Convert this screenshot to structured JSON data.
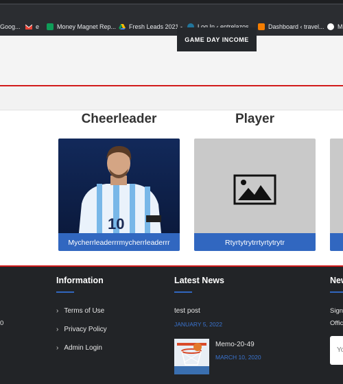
{
  "bookmarks": [
    {
      "label": "Goog...",
      "icon": "google-icon",
      "color": "#4285f4"
    },
    {
      "label": "e",
      "icon": "gmail-icon",
      "color": "#ea4335"
    },
    {
      "label": "Money Magnet Rep...",
      "icon": "sheets-icon",
      "color": "#0f9d58"
    },
    {
      "label": "Fresh Leads 2021 -...",
      "icon": "drive-icon",
      "color": "#fbbc04"
    },
    {
      "label": "Log In ‹ entrelazos....",
      "icon": "wordpress-icon",
      "color": "#21759b"
    },
    {
      "label": "Dashboard ‹ travel...",
      "icon": "blogger-icon",
      "color": "#f57d00"
    },
    {
      "label": "M",
      "icon": "globe-icon",
      "color": "#ffffff"
    }
  ],
  "hero": {
    "button_label": "GAME DAY INCOME"
  },
  "sections": {
    "cheerleader": {
      "heading": "Cheerleader",
      "card_label": "Mycherrleaderrrmycherrleaderrr"
    },
    "player": {
      "heading": "Player",
      "card_label": "Rtyrtytrytrrtyrtytrytr"
    }
  },
  "footer": {
    "left_fragment": "0",
    "information": {
      "title": "Information",
      "links": [
        "Terms of Use",
        "Privacy Policy",
        "Admin Login"
      ]
    },
    "latest_news": {
      "title": "Latest News",
      "posts": [
        {
          "title": "test post",
          "date": "JANUARY 5, 2022"
        },
        {
          "title": "Memo-20-49",
          "date": "MARCH 10, 2020"
        }
      ]
    },
    "newsletter": {
      "title_fragment": "New",
      "line1": "Sign",
      "line2": "Offic",
      "input_fragment": "Yo"
    }
  },
  "colors": {
    "accent_blue": "#3167c0",
    "accent_red": "#d11a1a",
    "footer_bg": "#222427"
  }
}
